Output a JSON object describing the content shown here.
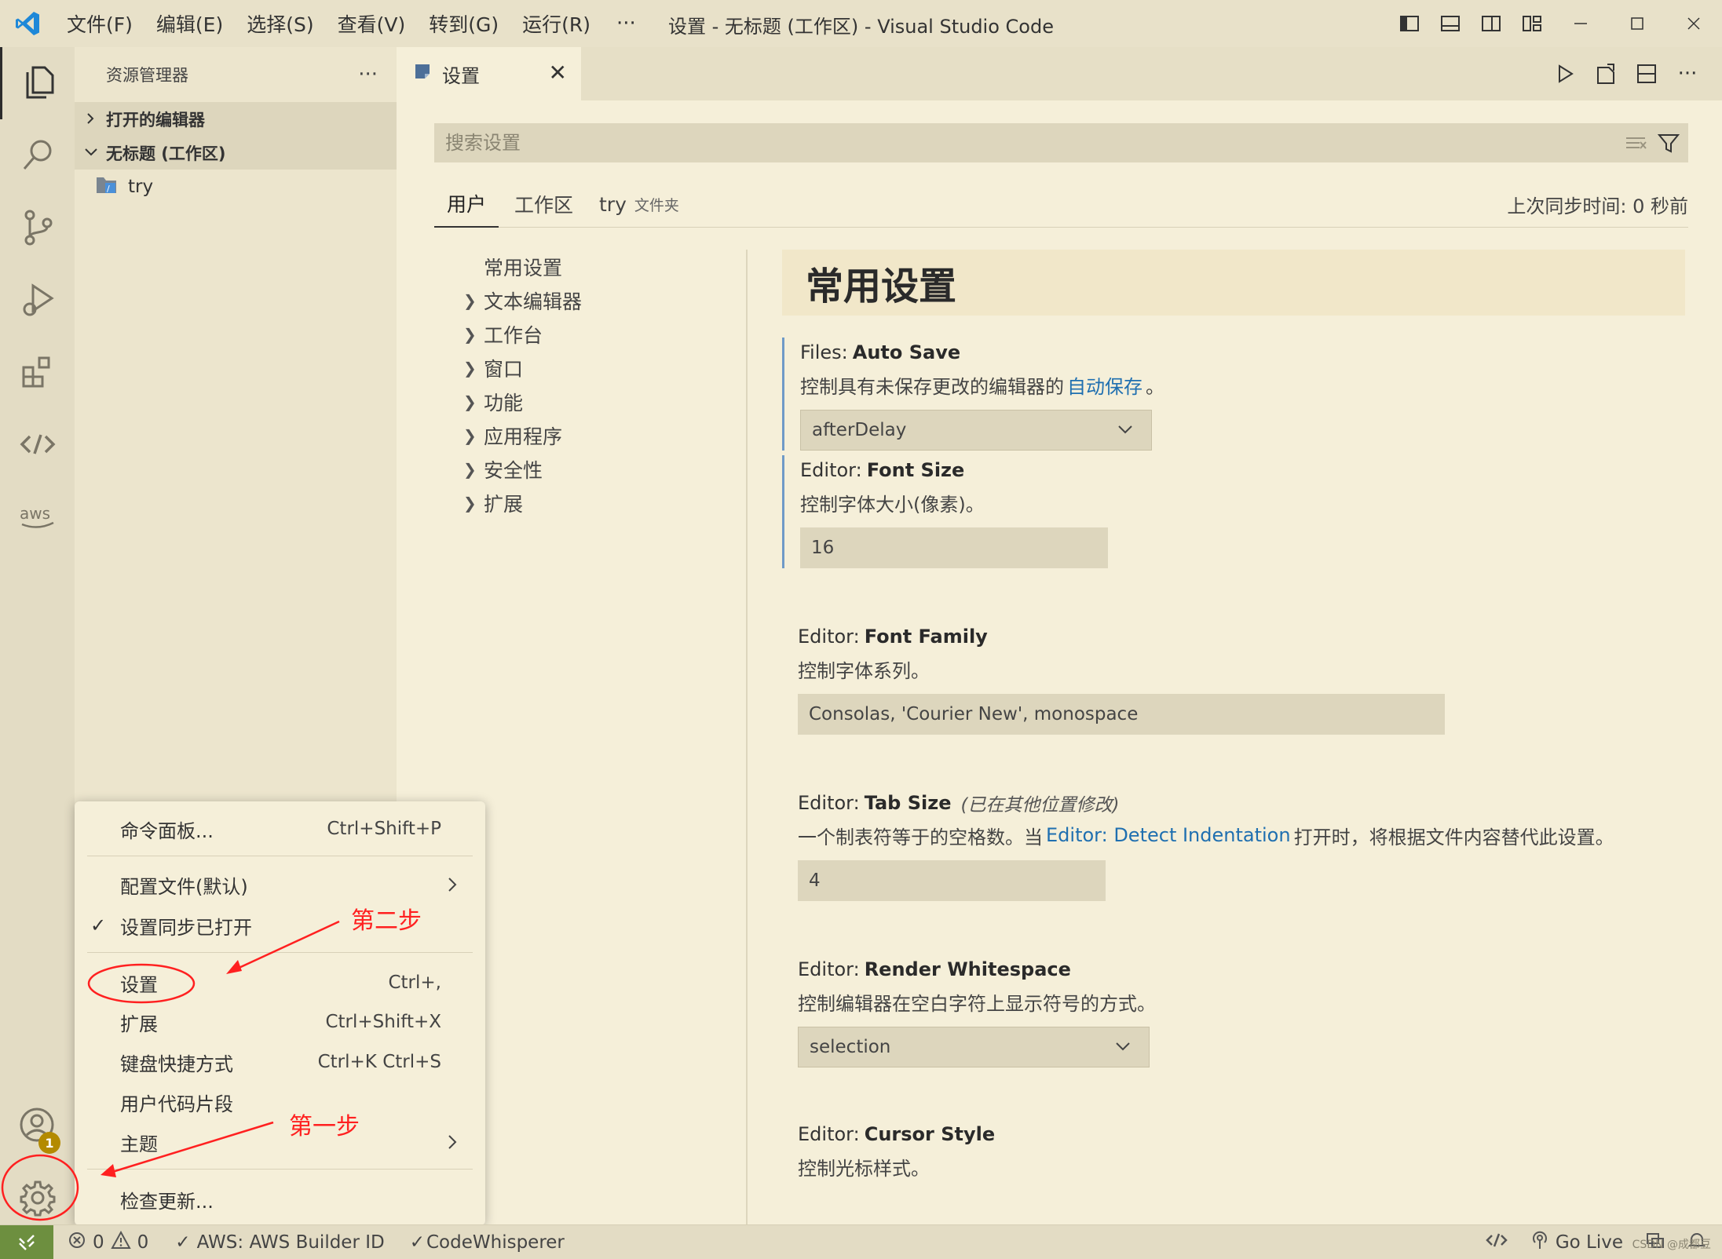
{
  "title_bar": {
    "menu": [
      "文件(F)",
      "编辑(E)",
      "选择(S)",
      "查看(V)",
      "转到(G)",
      "运行(R)"
    ],
    "more": "···",
    "window_title": "设置 - 无标题 (工作区) - Visual Studio Code"
  },
  "sidebar": {
    "title": "资源管理器",
    "more": "···",
    "sections": [
      {
        "label": "打开的编辑器",
        "expanded": false
      },
      {
        "label": "无标题 (工作区)",
        "expanded": true
      }
    ],
    "folder": "try"
  },
  "tab": {
    "label": "设置",
    "close": "✕"
  },
  "settings": {
    "search_placeholder": "搜索设置",
    "scopes": {
      "user": "用户",
      "workspace": "工作区",
      "folder": "try",
      "folder_note": "文件夹"
    },
    "sync_status": "上次同步时间: 0 秒前",
    "toc": [
      "常用设置",
      "文本编辑器",
      "工作台",
      "窗口",
      "功能",
      "应用程序",
      "安全性",
      "扩展"
    ],
    "group_title": "常用设置",
    "items": [
      {
        "category": "Files:",
        "name": "Auto Save",
        "desc": "控制具有未保存更改的编辑器的",
        "link": "自动保存",
        "desc_after": "。",
        "value": "afterDelay"
      },
      {
        "category": "Editor:",
        "name": "Font Size",
        "desc": "控制字体大小(像素)。",
        "value": "16"
      },
      {
        "category": "Editor:",
        "name": "Font Family",
        "desc": "控制字体系列。",
        "value": "Consolas, 'Courier New', monospace"
      },
      {
        "category": "Editor:",
        "name": "Tab Size",
        "note": "(已在其他位置修改)",
        "desc": "一个制表符等于的空格数。当",
        "link": "Editor: Detect Indentation",
        "desc_after": "打开时，将根据文件内容替代此设置。",
        "value": "4"
      },
      {
        "category": "Editor:",
        "name": "Render Whitespace",
        "desc": "控制编辑器在空白字符上显示符号的方式。",
        "value": "selection"
      },
      {
        "category": "Editor:",
        "name": "Cursor Style",
        "desc": "控制光标样式。"
      }
    ]
  },
  "context_menu": {
    "items": [
      {
        "label": "命令面板...",
        "shortcut": "Ctrl+Shift+P"
      },
      {
        "label": "配置文件(默认)"
      },
      {
        "label": "设置同步已打开",
        "checked": "✓"
      },
      {
        "label": "设置",
        "shortcut": "Ctrl+,"
      },
      {
        "label": "扩展",
        "shortcut": "Ctrl+Shift+X"
      },
      {
        "label": "键盘快捷方式",
        "shortcut": "Ctrl+K Ctrl+S"
      },
      {
        "label": "用户代码片段"
      },
      {
        "label": "主题"
      },
      {
        "label": "检查更新..."
      }
    ]
  },
  "annotations": {
    "step1": "第一步",
    "step2": "第二步"
  },
  "accounts_badge": "1",
  "status_bar": {
    "errors": "0",
    "warnings": "0",
    "aws": "AWS: AWS Builder ID",
    "codewhisperer": "CodeWhisperer",
    "go_live": "Go Live",
    "watermark": "CSDN @成都豆"
  },
  "colors": {
    "accent_link": "#1f6fb0",
    "annotation_red": "#ff2020",
    "remote_green": "#6d8f3f",
    "badge": "#b38a00",
    "modified_bar": "#6f9ac7"
  }
}
